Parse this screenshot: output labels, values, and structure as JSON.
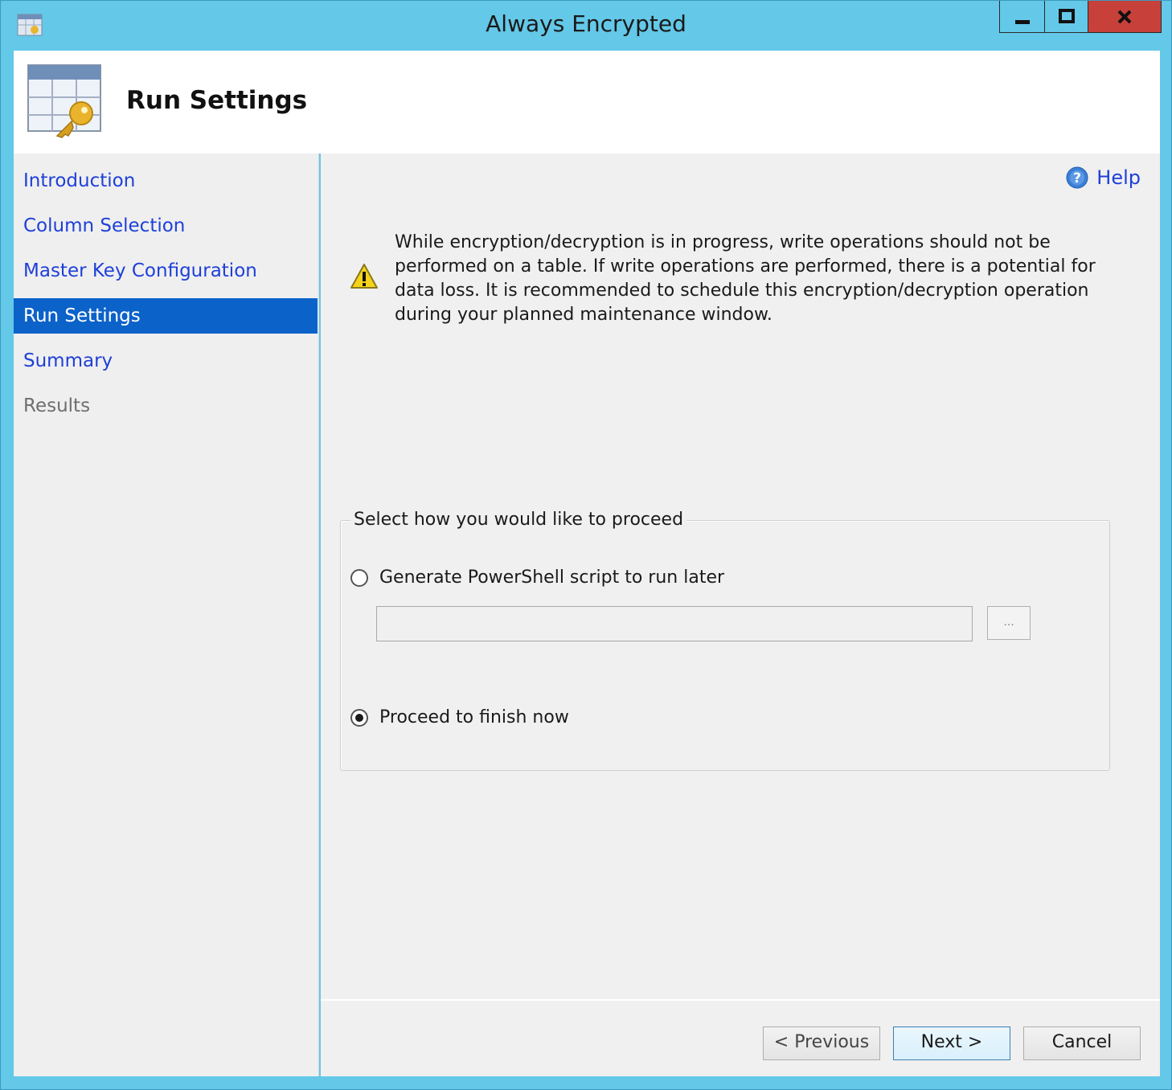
{
  "window": {
    "title": "Always Encrypted"
  },
  "header": {
    "title": "Run Settings"
  },
  "sidebar": {
    "items": [
      {
        "label": "Introduction",
        "state": "link"
      },
      {
        "label": "Column Selection",
        "state": "link"
      },
      {
        "label": "Master Key Configuration",
        "state": "link"
      },
      {
        "label": "Run Settings",
        "state": "active"
      },
      {
        "label": "Summary",
        "state": "link"
      },
      {
        "label": "Results",
        "state": "disabled"
      }
    ]
  },
  "content": {
    "help_label": "Help",
    "warning_text": "While encryption/decryption is in progress, write operations should not be performed on a table. If write operations are performed, there is a potential for data loss. It is recommended to schedule this encryption/decryption operation during your planned maintenance window.",
    "group": {
      "legend": "Select how you would like to proceed",
      "option_script": {
        "label": "Generate PowerShell script to run later",
        "checked": false
      },
      "script_path": {
        "value": ""
      },
      "browse_label": "...",
      "option_proceed": {
        "label": "Proceed to finish now",
        "checked": true
      }
    }
  },
  "footer": {
    "previous_label": "< Previous",
    "next_label": "Next >",
    "cancel_label": "Cancel"
  },
  "colors": {
    "titlebar": "#64c8e8",
    "close_button": "#c7403a",
    "nav_active": "#0b62c9",
    "link": "#1e40d8"
  }
}
